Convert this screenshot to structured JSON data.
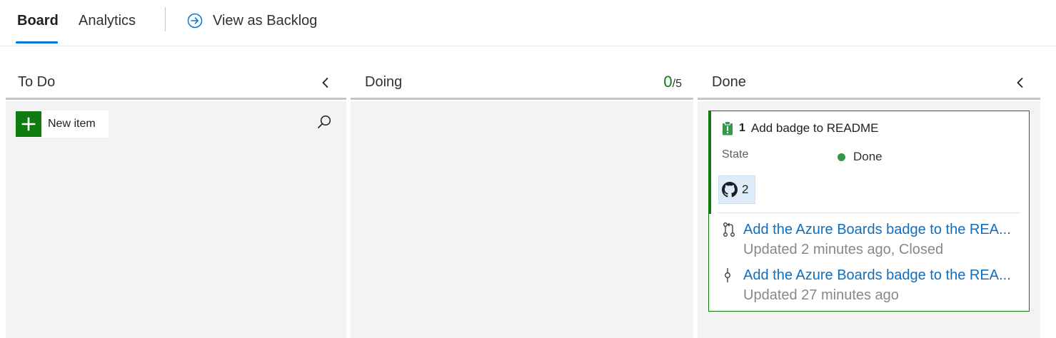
{
  "tabs": {
    "board": "Board",
    "analytics": "Analytics",
    "view_as_backlog": "View as Backlog"
  },
  "columns": {
    "todo": {
      "title": "To Do",
      "new_item_label": "New item"
    },
    "doing": {
      "title": "Doing",
      "wip_current": "0",
      "wip_limit": "/5"
    },
    "done": {
      "title": "Done"
    }
  },
  "card": {
    "id": "1",
    "title": "Add badge to README",
    "state_label": "State",
    "state_value": "Done",
    "state_color": "#339947",
    "github_link_count": "2",
    "links": [
      {
        "icon": "pull-request-icon",
        "title": "Add the Azure Boards badge to the REA...",
        "subtitle": "Updated 2 minutes ago, Closed"
      },
      {
        "icon": "commit-icon",
        "title": "Add the Azure Boards badge to the REA...",
        "subtitle": "Updated 27 minutes ago"
      }
    ]
  },
  "colors": {
    "accent": "#0078d4",
    "green": "#107c10",
    "link": "#106ebe"
  }
}
